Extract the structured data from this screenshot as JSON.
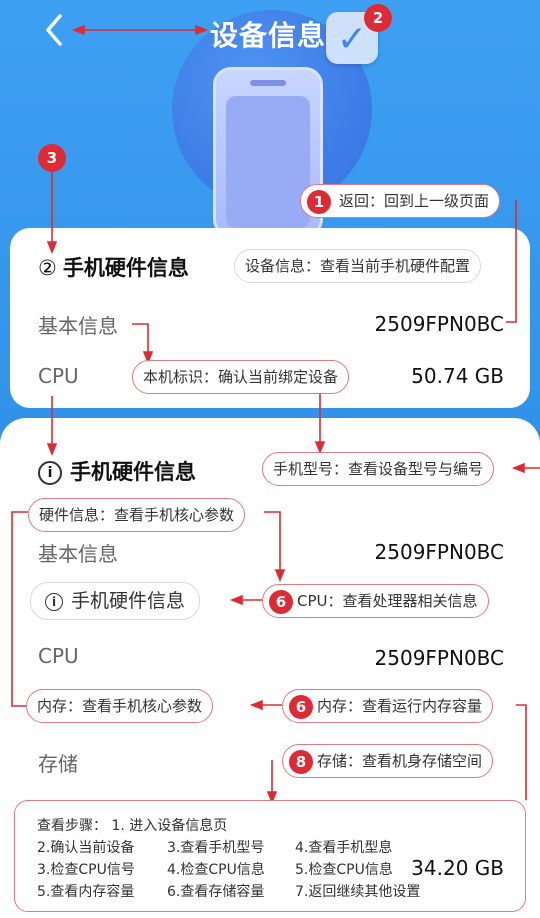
{
  "header": {
    "title": "设备信息",
    "back_icon": "chevron-left-icon",
    "badge_icon": "checkmark-icon"
  },
  "card1": {
    "section_num": "②",
    "section_title": "手机硬件信息",
    "rows": [
      {
        "label": "基本信息",
        "value": "2509FPN0BC"
      },
      {
        "label": "CPU",
        "value": "50.74 GB"
      }
    ]
  },
  "card2": {
    "section_icon": "info-icon",
    "section_title": "手机硬件信息",
    "rows": [
      {
        "label": "基本信息",
        "value": "2509FPN0BC"
      },
      {
        "label": "CPU",
        "value": "2509FPN0BC"
      },
      {
        "label": "存储",
        "value": "34.20 GB"
      }
    ],
    "info_pill": "手机硬件信息"
  },
  "annotations": {
    "badge1": "1",
    "badge2": "2",
    "badge3": "3",
    "badge6a": "6",
    "badge6b": "6",
    "badge8": "8",
    "back": "返回：回到上一级页面",
    "device_info": "设备信息：查看当前手机硬件配置",
    "device_id": "本机标识：确认当前绑定设备",
    "model": "手机型号：查看设备型号与编号",
    "hardware": "硬件信息：查看手机核心参数",
    "cpu": "CPU：查看处理器相关信息",
    "mem_left": "内存：查看手机核心参数",
    "mem_right": "内存：查看运行内存容量",
    "storage": "存储：查看机身存储空间"
  },
  "steps": {
    "line1": "查看步骤：  1. 进入设备信息页",
    "c1": [
      "2.确认当前设备",
      "3.检查CPU信号",
      "5.查看内存容量"
    ],
    "c2": [
      "3.查看手机型号",
      "4.检查CPU信息",
      "6.查看存储容量"
    ],
    "c3": [
      "4.查看手机型息",
      "5.检查CPU信息",
      "7.返回继续其他设置"
    ]
  },
  "colors": {
    "accent": "#2d8ee8",
    "annotation": "#e02a33"
  }
}
